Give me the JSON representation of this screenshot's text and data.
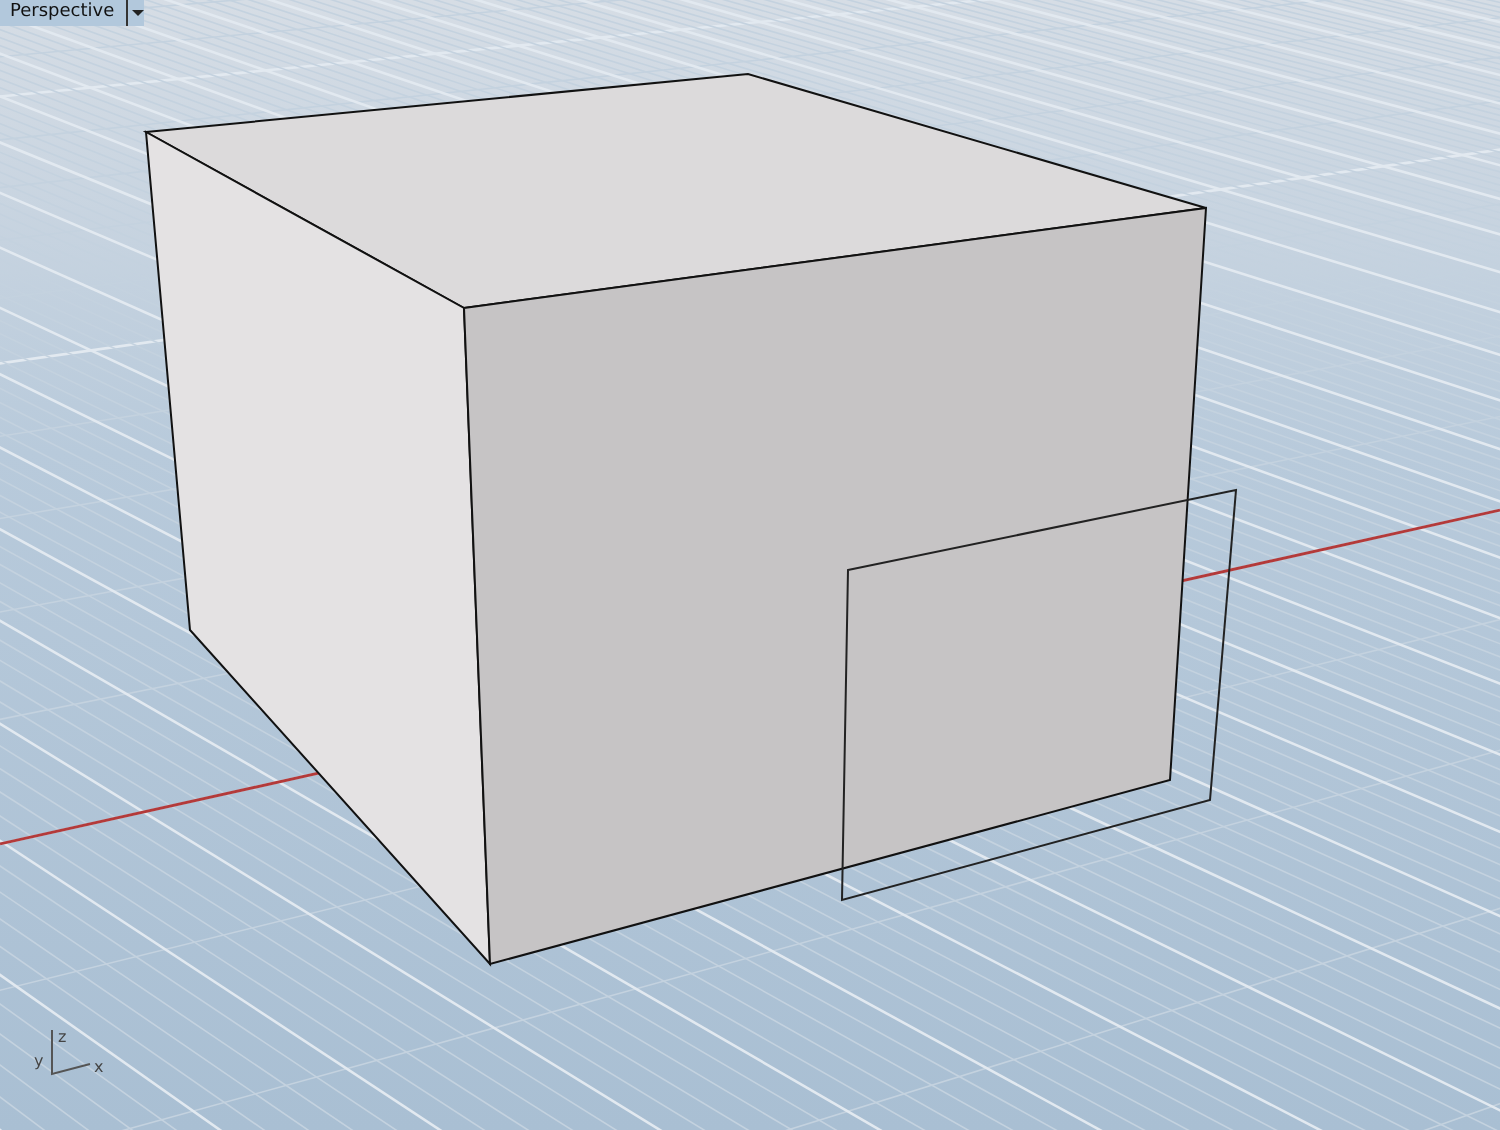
{
  "viewport": {
    "title": "Perspective",
    "axes": {
      "z": "z",
      "y": "y",
      "x": "x"
    }
  }
}
